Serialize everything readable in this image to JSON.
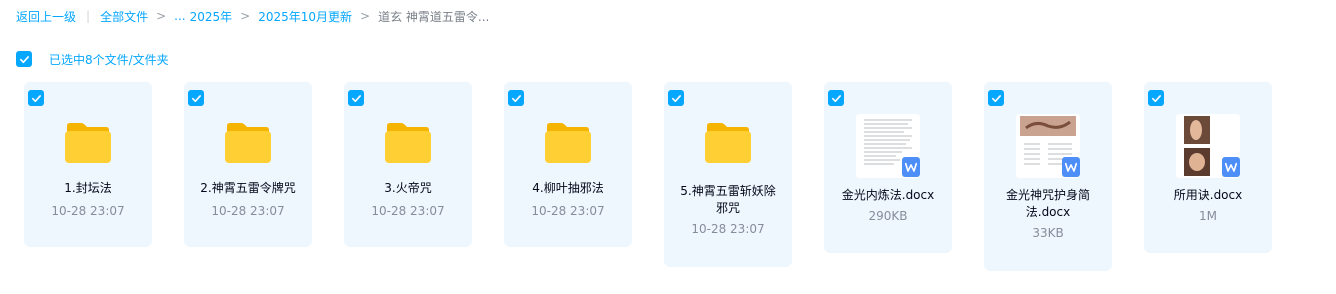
{
  "breadcrumb": {
    "back": "返回上一级",
    "all_files": "全部文件",
    "ellipsis": "...",
    "year": "2025年",
    "month": "2025年10月更新",
    "current": "道玄 神霄道五雷令..."
  },
  "selection": {
    "text": "已选中8个文件/文件夹",
    "checked": true
  },
  "items": [
    {
      "type": "folder",
      "name": "1.封坛法",
      "meta": "10-28 23:07",
      "checked": true
    },
    {
      "type": "folder",
      "name": "2.神霄五雷令牌咒",
      "meta": "10-28 23:07",
      "checked": true
    },
    {
      "type": "folder",
      "name": "3.火帝咒",
      "meta": "10-28 23:07",
      "checked": true
    },
    {
      "type": "folder",
      "name": "4.柳叶抽邪法",
      "meta": "10-28 23:07",
      "checked": true
    },
    {
      "type": "folder",
      "name": "5.神霄五雷斩妖除邪咒",
      "meta": "10-28 23:07",
      "checked": true
    },
    {
      "type": "docx",
      "name": "金光内炼法.docx",
      "meta": "290KB",
      "checked": true
    },
    {
      "type": "docx",
      "name": "金光神咒护身简法.docx",
      "meta": "33KB",
      "checked": true
    },
    {
      "type": "docx",
      "name": "所用诀.docx",
      "meta": "1M",
      "checked": true
    }
  ],
  "colors": {
    "accent": "#06a7ff",
    "card_bg": "#eef7fe",
    "folder": "#ffcc33",
    "wps": "#4e8ef7"
  }
}
